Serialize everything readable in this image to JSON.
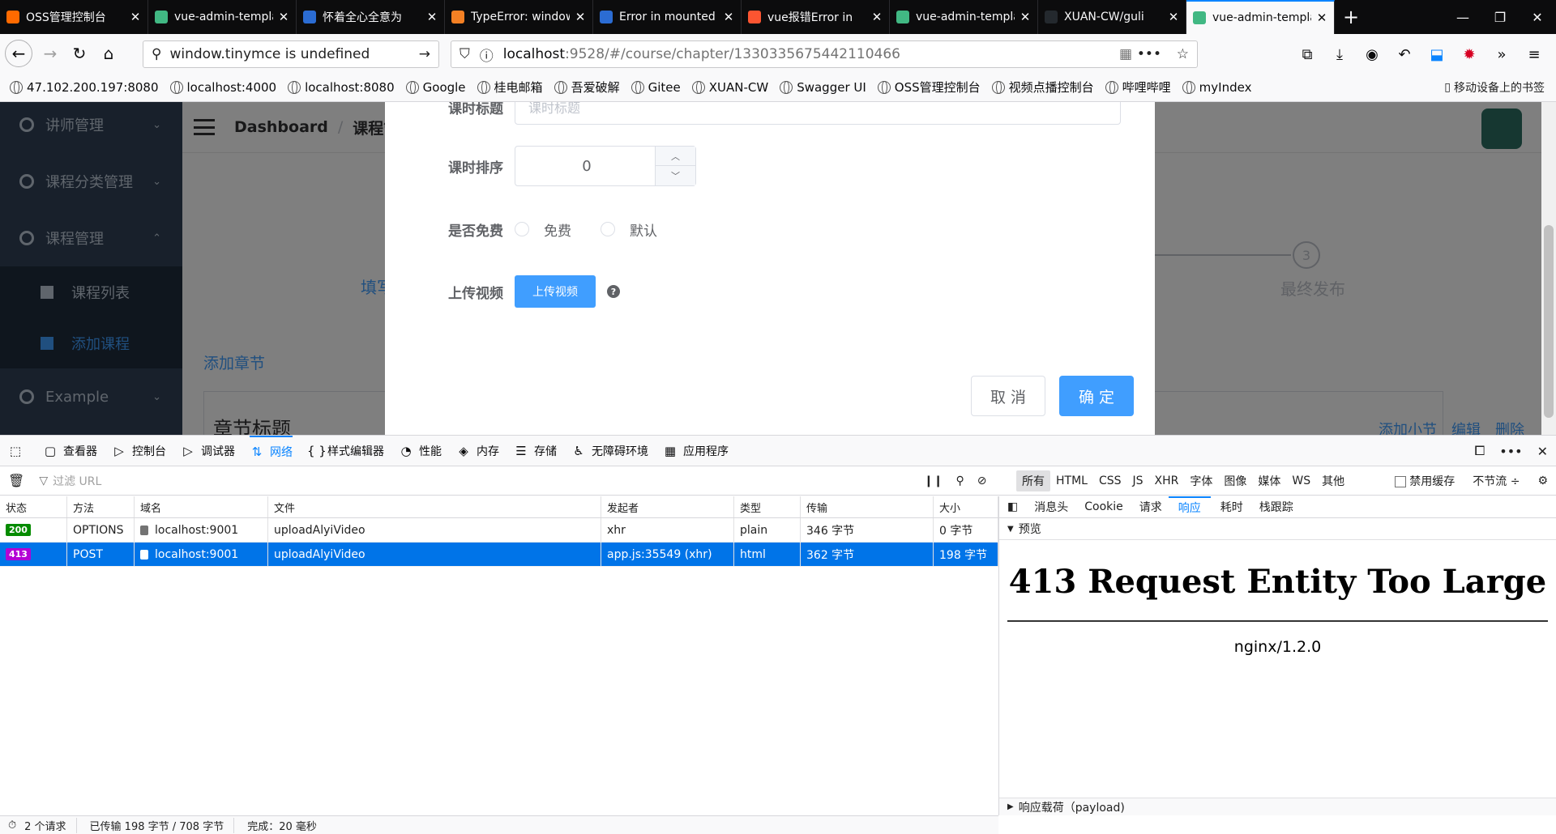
{
  "tabs": [
    {
      "title": "OSS管理控制台",
      "color": "#ff6a00",
      "icon": "aliyun-icon"
    },
    {
      "title": "vue-admin-template",
      "color": "#41b883",
      "icon": "vue-icon"
    },
    {
      "title": "怀着全心全意为",
      "color": "#2b6cd3",
      "icon": "baidu-icon"
    },
    {
      "title": "TypeError: window",
      "color": "#f48024",
      "icon": "stackoverflow-icon"
    },
    {
      "title": "Error in mounted",
      "color": "#2b6cd3",
      "icon": "baidu-icon"
    },
    {
      "title": "vue报错Error in",
      "color": "#fc5531",
      "icon": "csdn-icon"
    },
    {
      "title": "vue-admin-template",
      "color": "#41b883",
      "icon": "vue-icon"
    },
    {
      "title": "XUAN-CW/guli",
      "color": "#24292e",
      "icon": "github-icon"
    },
    {
      "title": "vue-admin-template",
      "color": "#41b883",
      "icon": "vue-icon",
      "active": true
    }
  ],
  "nav": {
    "search_text": "window.tinymce is undefined",
    "url_host": "localhost",
    "url_path": ":9528/#/course/chapter/1330335675442110466"
  },
  "bookmarks": [
    "47.102.200.197:8080",
    "localhost:4000",
    "localhost:8080",
    "Google",
    "桂电邮箱",
    "吾爱破解",
    "Gitee",
    "XUAN-CW",
    "Swagger UI",
    "OSS管理控制台",
    "视频点播控制台",
    "哔哩哔哩",
    "myIndex"
  ],
  "bookmarks_mobile": "移动设备上的书签",
  "sidebar": {
    "items": [
      "讲师管理",
      "课程分类管理",
      "课程管理"
    ],
    "subitems": [
      "课程列表",
      "添加课程"
    ],
    "example": "Example"
  },
  "breadcrumb": {
    "root": "Dashboard",
    "current": "课程管理"
  },
  "steps": {
    "left_partial": "填写",
    "step3_num": "3",
    "step3_label": "最终发布"
  },
  "chapter": {
    "add_chapter": "添加章节",
    "title": "章节标题",
    "add_section": "添加小节",
    "edit": "编辑",
    "delete": "删除"
  },
  "dialog": {
    "title_label": "课时标题",
    "title_placeholder": "课时标题",
    "sort_label": "课时排序",
    "sort_value": "0",
    "free_label": "是否免费",
    "free_option": "免费",
    "default_option": "默认",
    "upload_label": "上传视频",
    "upload_button": "上传视频",
    "cancel": "取 消",
    "confirm": "确 定"
  },
  "devtools": {
    "tabs": [
      "查看器",
      "控制台",
      "调试器",
      "网络",
      "样式编辑器",
      "性能",
      "内存",
      "存储",
      "无障碍环境",
      "应用程序"
    ],
    "active_tab": "网络",
    "filter_placeholder": "过滤 URL",
    "type_filters": [
      "所有",
      "HTML",
      "CSS",
      "JS",
      "XHR",
      "字体",
      "图像",
      "媒体",
      "WS",
      "其他"
    ],
    "disable_cache": "禁用缓存",
    "throttle": "不节流 ÷",
    "columns": [
      "状态",
      "方法",
      "域名",
      "文件",
      "发起者",
      "类型",
      "传输",
      "大小"
    ],
    "rows": [
      {
        "status": "200",
        "method": "OPTIONS",
        "domain": "localhost:9001",
        "file": "uploadAlyiVideo",
        "initiator": "xhr",
        "type": "plain",
        "transfer": "346 字节",
        "size": "0 字节"
      },
      {
        "status": "413",
        "method": "POST",
        "domain": "localhost:9001",
        "file": "uploadAlyiVideo",
        "initiator": "app.js:35549 (xhr)",
        "type": "html",
        "transfer": "362 字节",
        "size": "198 字节"
      }
    ],
    "side_tabs": [
      "消息头",
      "Cookie",
      "请求",
      "响应",
      "耗时",
      "栈跟踪"
    ],
    "side_active": "响应",
    "preview_label": "预览",
    "response_title": "413 Request Entity Too Large",
    "response_server": "nginx/1.2.0",
    "payload_label": "响应载荷（payload)",
    "status": {
      "requests": "2 个请求",
      "transferred": "已传输 198 字节 / 708 字节",
      "finish": "完成：20 毫秒"
    }
  }
}
